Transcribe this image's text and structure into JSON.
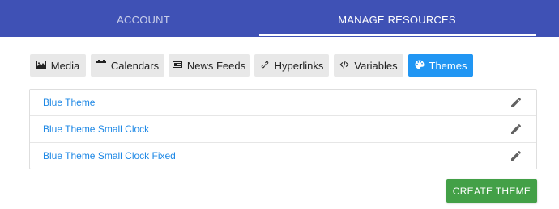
{
  "header": {
    "tabs": [
      {
        "label": "ACCOUNT",
        "active": false
      },
      {
        "label": "MANAGE RESOURCES",
        "active": true
      }
    ],
    "color": "#3f51b5"
  },
  "resource_tabs": [
    {
      "label": "Media",
      "icon": "image-icon",
      "active": false
    },
    {
      "label": "Calendars",
      "icon": "calendar-icon",
      "active": false
    },
    {
      "label": "News Feeds",
      "icon": "newspaper-icon",
      "active": false
    },
    {
      "label": "Hyperlinks",
      "icon": "link-icon",
      "active": false
    },
    {
      "label": "Variables",
      "icon": "code-icon",
      "active": false
    },
    {
      "label": "Themes",
      "icon": "palette-icon",
      "active": true
    }
  ],
  "themes": [
    {
      "name": "Blue Theme",
      "action_icon": "pencil-icon"
    },
    {
      "name": "Blue Theme Small Clock",
      "action_icon": "pencil-icon"
    },
    {
      "name": "Blue Theme Small Clock Fixed",
      "action_icon": "pencil-icon"
    }
  ],
  "create_button": {
    "label": "CREATE THEME",
    "color": "#43a047"
  },
  "accent_color": "#2196f3"
}
